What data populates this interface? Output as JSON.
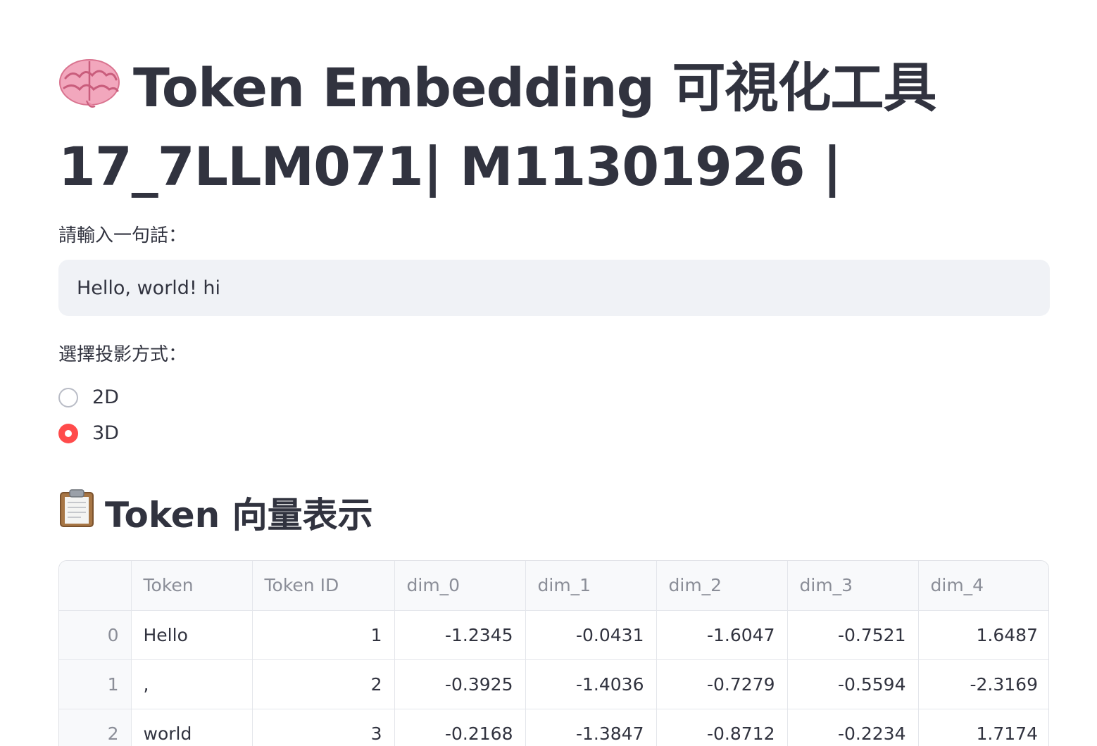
{
  "title": {
    "line1": "Token Embedding 可視化工具",
    "line2": "17_7LLM071| M11301926 |"
  },
  "input": {
    "label": "請輸入一句話：",
    "value": "Hello, world! hi"
  },
  "projection": {
    "label": "選擇投影方式：",
    "options": [
      {
        "label": "2D",
        "selected": false
      },
      {
        "label": "3D",
        "selected": true
      }
    ],
    "accent_color": "#ff4b4b"
  },
  "section": {
    "title": "Token 向量表示"
  },
  "table": {
    "columns": [
      "",
      "Token",
      "Token ID",
      "dim_0",
      "dim_1",
      "dim_2",
      "dim_3",
      "dim_4"
    ],
    "rows": [
      {
        "index": "0",
        "token": "Hello",
        "token_id": "1",
        "dim_0": "-1.2345",
        "dim_1": "-0.0431",
        "dim_2": "-1.6047",
        "dim_3": "-0.7521",
        "dim_4": "1.6487"
      },
      {
        "index": "1",
        "token": ",",
        "token_id": "2",
        "dim_0": "-0.3925",
        "dim_1": "-1.4036",
        "dim_2": "-0.7279",
        "dim_3": "-0.5594",
        "dim_4": "-2.3169"
      },
      {
        "index": "2",
        "token": "world",
        "token_id": "3",
        "dim_0": "-0.2168",
        "dim_1": "-1.3847",
        "dim_2": "-0.8712",
        "dim_3": "-0.2234",
        "dim_4": "1.7174"
      }
    ]
  },
  "icons": [
    "brain-icon",
    "clipboard-icon"
  ]
}
